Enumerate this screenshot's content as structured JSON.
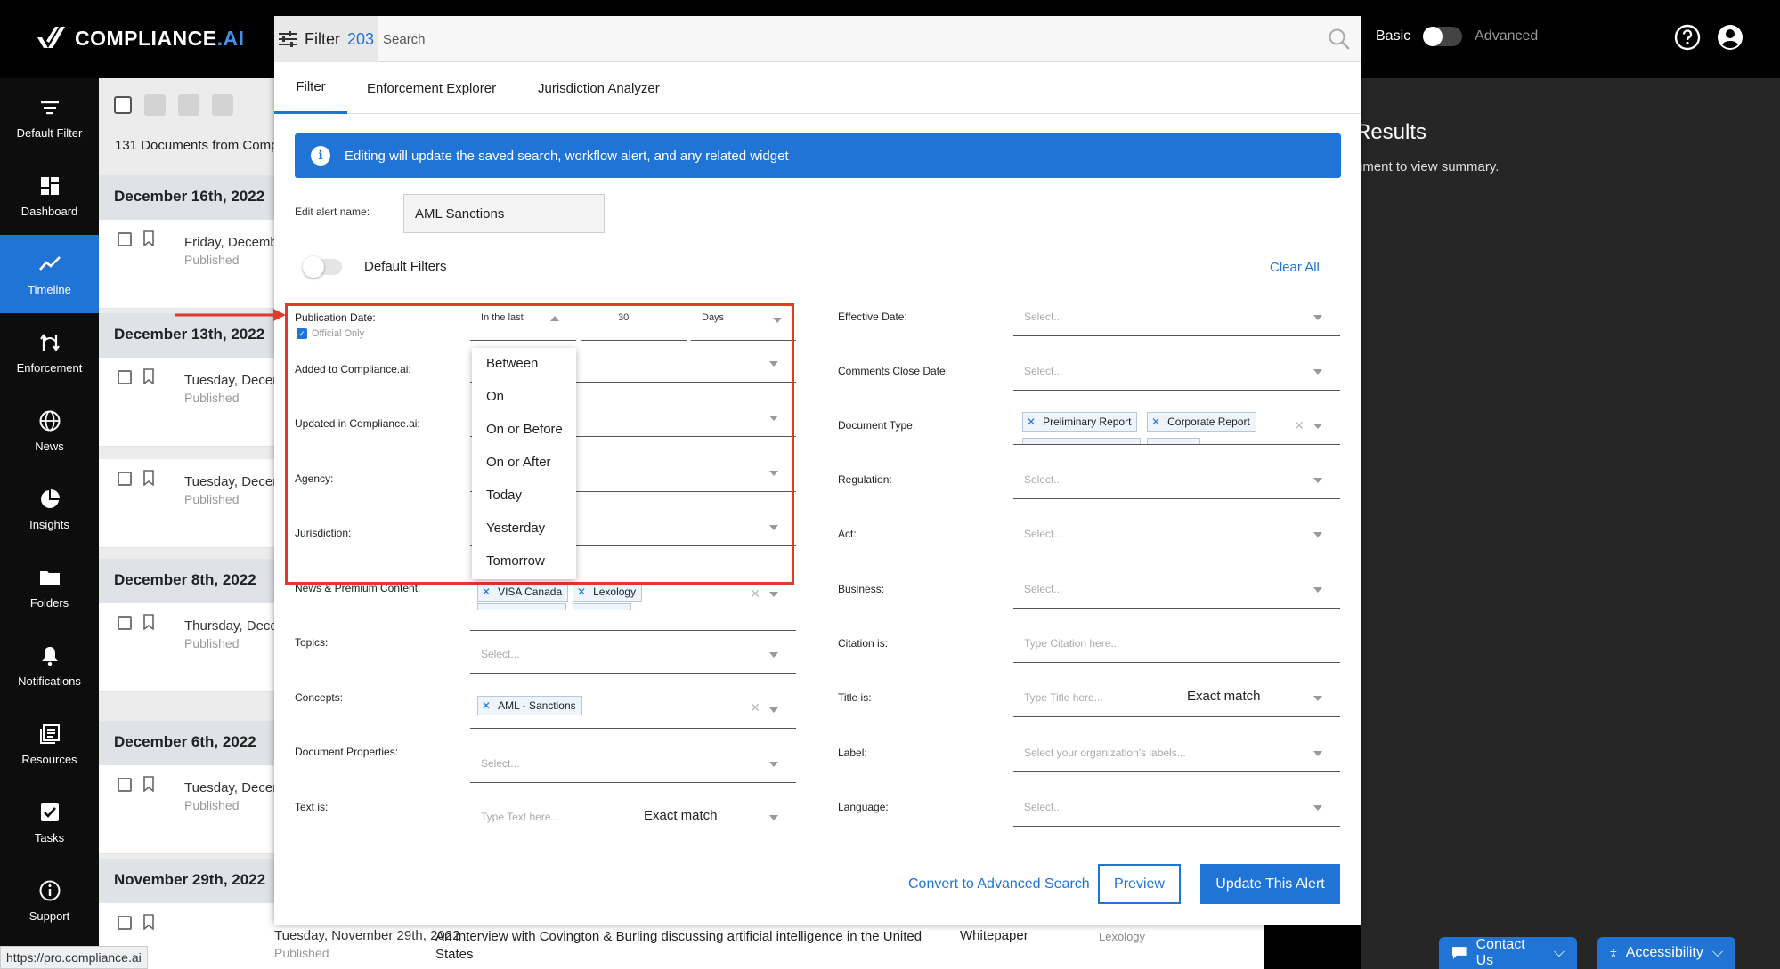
{
  "brand": {
    "name_main": "COMPLIANCE",
    "name_accent": ".AI"
  },
  "mode": {
    "basic": "Basic",
    "advanced": "Advanced"
  },
  "sidebar": {
    "items": [
      {
        "label": "Default Filter",
        "icon": "filter-lines-icon"
      },
      {
        "label": "Dashboard",
        "icon": "dashboard-icon"
      },
      {
        "label": "Timeline",
        "icon": "timeline-icon",
        "active": true
      },
      {
        "label": "Enforcement",
        "icon": "enforcement-icon"
      },
      {
        "label": "News",
        "icon": "globe-icon"
      },
      {
        "label": "Insights",
        "icon": "pie-chart-icon"
      },
      {
        "label": "Folders",
        "icon": "folder-icon"
      },
      {
        "label": "Notifications",
        "icon": "bell-icon"
      },
      {
        "label": "Resources",
        "icon": "resources-icon"
      },
      {
        "label": "Tasks",
        "icon": "checkbox-icon"
      },
      {
        "label": "Support",
        "icon": "info-circle-icon"
      }
    ]
  },
  "list": {
    "count_text": "131 Documents from Comp",
    "groups": [
      {
        "date": "December 16th, 2022",
        "rows": [
          {
            "day": "Friday, Decemb",
            "status": "Published"
          }
        ]
      },
      {
        "date": "December 13th, 2022",
        "rows": [
          {
            "day": "Tuesday, Decer",
            "status": "Published"
          },
          {
            "day": "Tuesday, Decer",
            "status": "Published"
          }
        ]
      },
      {
        "date": "December 8th, 2022",
        "rows": [
          {
            "day": "Thursday, Dece",
            "status": "Published"
          }
        ]
      },
      {
        "date": "December 6th, 2022",
        "rows": [
          {
            "day": "Tuesday, Decer",
            "status": "Published"
          }
        ]
      },
      {
        "date": "November 29th, 2022",
        "rows": []
      }
    ],
    "bottom_row": {
      "day": "Tuesday, November 29th, 2022",
      "status": "Published",
      "title": "An interview with Covington & Burling discussing artificial intelligence in the United States",
      "doc_type": "Whitepaper",
      "source": "Lexology"
    }
  },
  "results": {
    "title": "Results",
    "subtitle": "ument to view summary."
  },
  "status_url": "https://pro.compliance.ai",
  "floating": {
    "contact": "Contact Us",
    "accessibility": "Accessibility"
  },
  "modal": {
    "filter_label": "Filter",
    "filter_count": "203",
    "search_placeholder": "Search",
    "tabs": [
      "Filter",
      "Enforcement Explorer",
      "Jurisdiction Analyzer"
    ],
    "banner": "Editing will update the saved search, workflow alert, and any related widget",
    "alert_name_label": "Edit alert name:",
    "alert_name_value": "AML Sanctions",
    "default_filters_label": "Default Filters",
    "clear_all": "Clear All",
    "publication": {
      "label": "Publication Date:",
      "official_only": "Official Only",
      "mode": "In the last",
      "number": "30",
      "unit": "Days"
    },
    "left_fields": [
      {
        "label": "Added to Compliance.ai:"
      },
      {
        "label": "Updated in Compliance.ai:"
      },
      {
        "label": "Agency:"
      },
      {
        "label": "Jurisdiction:"
      },
      {
        "label": "News & Premium Content:",
        "chips": [
          "VISA Canada",
          "Lexology"
        ]
      },
      {
        "label": "Topics:",
        "placeholder": "Select..."
      },
      {
        "label": "Concepts:",
        "chips": [
          "AML - Sanctions"
        ]
      },
      {
        "label": "Document Properties:",
        "placeholder": "Select..."
      },
      {
        "label": "Text is:",
        "placeholder": "Type Text here...",
        "match": "Exact match"
      }
    ],
    "right_fields": [
      {
        "label": "Effective Date:",
        "placeholder": "Select..."
      },
      {
        "label": "Comments Close Date:",
        "placeholder": "Select..."
      },
      {
        "label": "Document Type:",
        "chips": [
          "Preliminary Report",
          "Corporate Report"
        ]
      },
      {
        "label": "Regulation:",
        "placeholder": "Select..."
      },
      {
        "label": "Act:",
        "placeholder": "Select..."
      },
      {
        "label": "Business:",
        "placeholder": "Select..."
      },
      {
        "label": "Citation is:",
        "placeholder": "Type Citation here..."
      },
      {
        "label": "Title is:",
        "placeholder": "Type Title here...",
        "match": "Exact match"
      },
      {
        "label": "Label:",
        "placeholder": "Select your organization's labels..."
      },
      {
        "label": "Language:",
        "placeholder": "Select..."
      }
    ],
    "date_options": [
      "Between",
      "On",
      "On or Before",
      "On or After",
      "Today",
      "Yesterday",
      "Tomorrow"
    ],
    "buttons": {
      "convert": "Convert to Advanced Search",
      "preview": "Preview",
      "update": "Update This Alert"
    }
  },
  "colors": {
    "accent": "#1f74d6",
    "highlight": "#e23a2a",
    "sidebar_bg": "#0d0d0d"
  }
}
